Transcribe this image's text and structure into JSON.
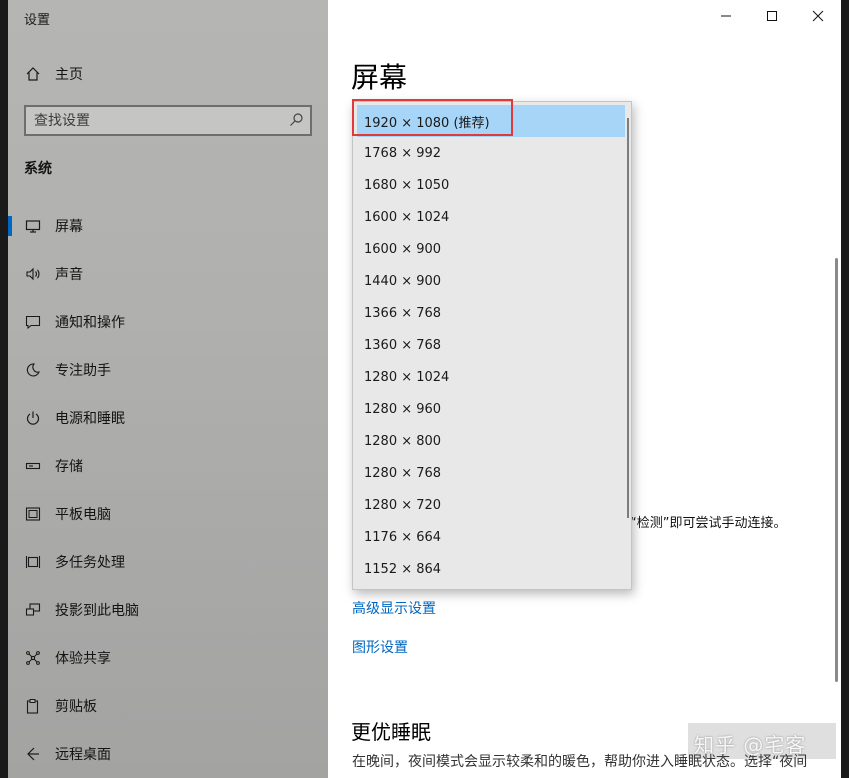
{
  "window": {
    "app_title": "设置"
  },
  "sidebar": {
    "home": "主页",
    "search_placeholder": "查找设置",
    "section": "系统",
    "items": [
      {
        "label": "屏幕",
        "icon": "monitor-icon",
        "active": true
      },
      {
        "label": "声音",
        "icon": "speaker-icon"
      },
      {
        "label": "通知和操作",
        "icon": "notification-icon"
      },
      {
        "label": "专注助手",
        "icon": "moon-icon"
      },
      {
        "label": "电源和睡眠",
        "icon": "power-icon"
      },
      {
        "label": "存储",
        "icon": "storage-icon"
      },
      {
        "label": "平板电脑",
        "icon": "tablet-icon"
      },
      {
        "label": "多任务处理",
        "icon": "multitask-icon"
      },
      {
        "label": "投影到此电脑",
        "icon": "project-icon"
      },
      {
        "label": "体验共享",
        "icon": "share-icon"
      },
      {
        "label": "剪贴板",
        "icon": "clipboard-icon"
      },
      {
        "label": "远程桌面",
        "icon": "remote-icon"
      }
    ]
  },
  "main": {
    "title": "屏幕",
    "detect_text": "“检测”即可尝试手动连接。",
    "advanced_link": "高级显示设置",
    "graphics_link": "图形设置",
    "night_heading": "更优睡眠",
    "night_para": "在晚间，夜间模式会显示较柔和的暖色，帮助你进入睡眠状态。选择“夜间"
  },
  "resolution_dropdown": {
    "selected_index": 0,
    "options": [
      "1920 × 1080 (推荐)",
      "1768 × 992",
      "1680 × 1050",
      "1600 × 1024",
      "1600 × 900",
      "1440 × 900",
      "1366 × 768",
      "1360 × 768",
      "1280 × 1024",
      "1280 × 960",
      "1280 × 800",
      "1280 × 768",
      "1280 × 720",
      "1176 × 664",
      "1152 × 864"
    ]
  },
  "watermark": "知乎 @宅客",
  "colors": {
    "accent": "#0067c0",
    "selection": "#a7d5f7",
    "highlight_box": "#e03a3a"
  }
}
